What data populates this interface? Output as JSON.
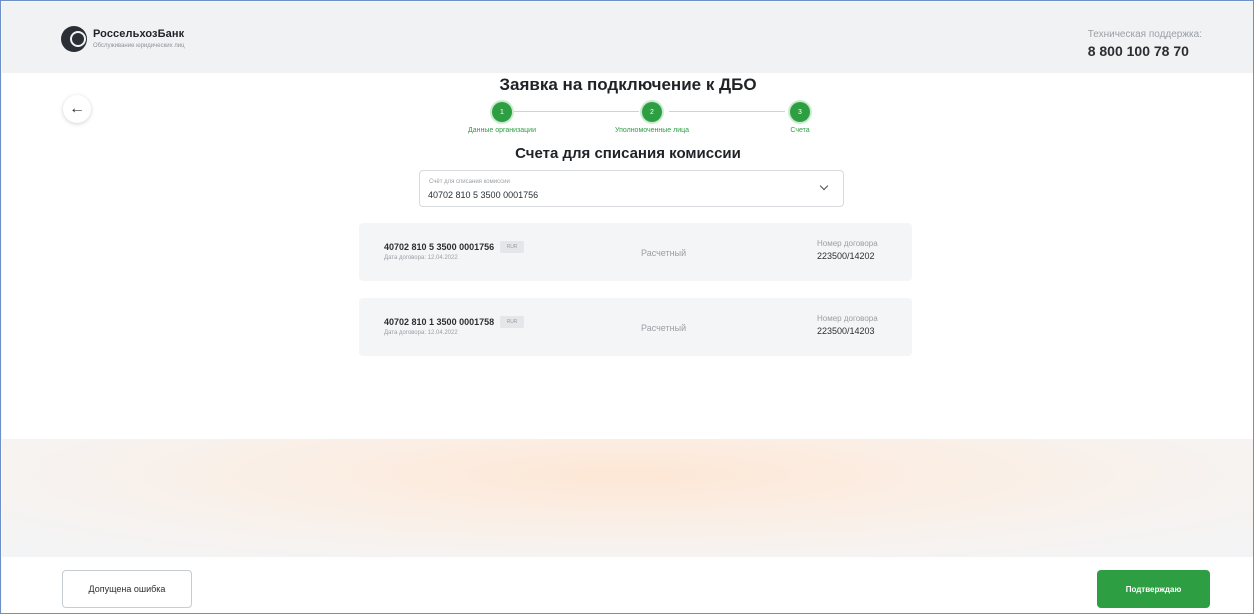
{
  "header": {
    "bank_name": "РоссельхозБанк",
    "bank_subtitle": "Обслуживание юридических лиц",
    "support_label": "Техническая поддержка:",
    "support_phone": "8 800 100 78 70"
  },
  "page": {
    "title": "Заявка на подключение к ДБО",
    "subtitle": "Счета для списания комиссии"
  },
  "stepper": {
    "steps": [
      {
        "number": "1",
        "label": "Данные организации"
      },
      {
        "number": "2",
        "label": "Уполномоченные лица"
      },
      {
        "number": "3",
        "label": "Счета"
      }
    ]
  },
  "select": {
    "label": "Счёт для списания комиссии",
    "value": "40702 810 5 3500 0001756"
  },
  "accounts": [
    {
      "number": "40702 810 5 3500 0001756",
      "currency": "RUR",
      "date": "Дата договора: 12.04.2022",
      "type": "Расчетный",
      "contract_label": "Номер договора",
      "contract_number": "223500/14202"
    },
    {
      "number": "40702 810 1 3500 0001758",
      "currency": "RUR",
      "date": "Дата договора: 12.04.2022",
      "type": "Расчетный",
      "contract_label": "Номер договора",
      "contract_number": "223500/14203"
    }
  ],
  "footer": {
    "error_button": "Допущена ошибка",
    "confirm_button": "Подтверждаю"
  },
  "colors": {
    "accent_green": "#2e9e43",
    "border_blue": "#6f8fc7"
  }
}
